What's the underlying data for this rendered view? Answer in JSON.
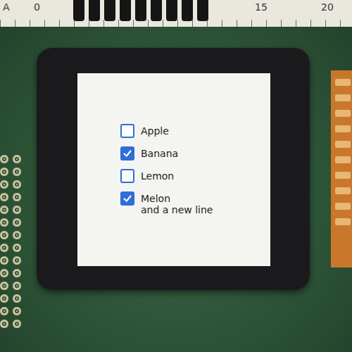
{
  "ruler": {
    "labels": [
      "A",
      "0",
      "15",
      "20"
    ]
  },
  "checkboxes": [
    {
      "label": "Apple",
      "checked": false
    },
    {
      "label": "Banana",
      "checked": true
    },
    {
      "label": "Lemon",
      "checked": false
    },
    {
      "label": "Melon\nand a new line",
      "checked": true
    }
  ]
}
